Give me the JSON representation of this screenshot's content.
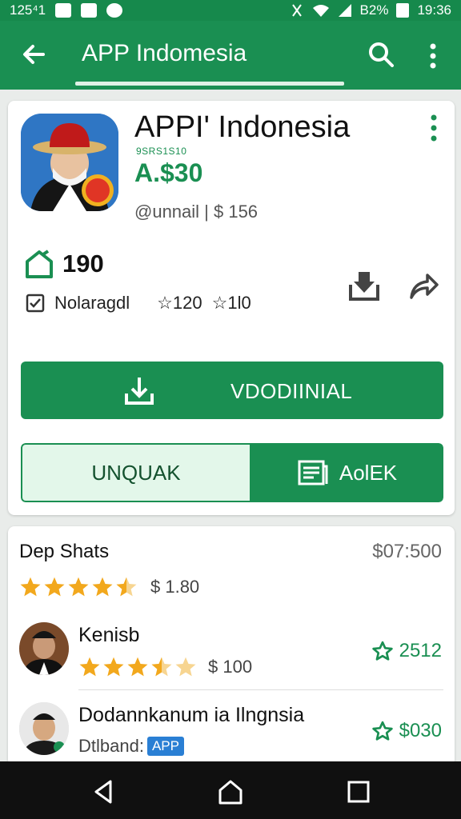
{
  "status_bar": {
    "time_left": "125⁴1",
    "battery": "B2%",
    "time_right": "19:36"
  },
  "app_bar": {
    "title": "APP Indomesia"
  },
  "app": {
    "name": "APPI' Indonesia",
    "developer": "9SRS1S10",
    "price": "A.$30",
    "meta": "@unnail | $ 156",
    "stat_count": "190",
    "category": "Nolaragdl",
    "rating_a": "☆120",
    "rating_b": "☆1l0"
  },
  "buttons": {
    "install": "VDODIINIAL",
    "left": "UNQUAK",
    "right": "AolEK"
  },
  "list": {
    "header": "Dep Shats",
    "header_value": "$07:500",
    "header_rating": "$ 1.80",
    "items": [
      {
        "name": "Kenisb",
        "sub_value": "$ 100",
        "right_value": "2512"
      },
      {
        "name": "Dodannkanum ia Ilngnsia",
        "sub_label": "Dtlband:",
        "badge": "APP",
        "right_value": "$030"
      }
    ]
  },
  "colors": {
    "brand_green": "#1a8f52",
    "star": "#f2a81d",
    "badge_blue": "#2a7fd4"
  },
  "icons": [
    "back-arrow-icon",
    "search-icon",
    "more-vert-icon",
    "home-outline-icon",
    "checkbox-icon",
    "install-icon",
    "share-icon",
    "download-icon",
    "list-icon",
    "star-icon",
    "back-nav-icon",
    "home-nav-icon",
    "recents-nav-icon"
  ]
}
